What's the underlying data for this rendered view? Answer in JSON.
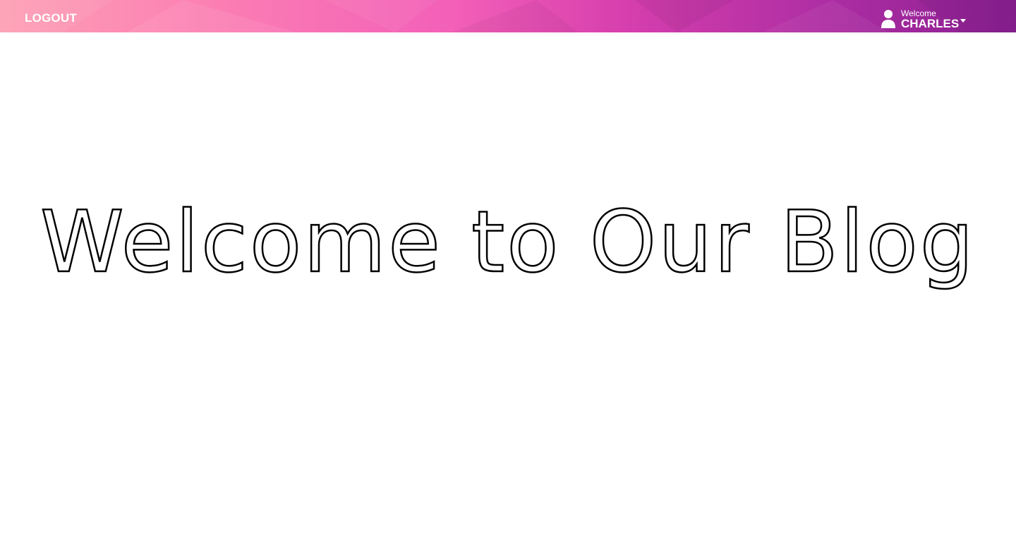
{
  "navbar": {
    "logout_label": "LOGOUT",
    "user_menu": {
      "greeting": "Welcome",
      "username": "CHARLES",
      "icon": "user-icon"
    },
    "gradient_colors": [
      "#fda0b4",
      "#fb7db3",
      "#f25fb8",
      "#d53ead",
      "#b02fa4",
      "#8a1f92"
    ]
  },
  "hero": {
    "title": "Welcome to Our Blog"
  }
}
